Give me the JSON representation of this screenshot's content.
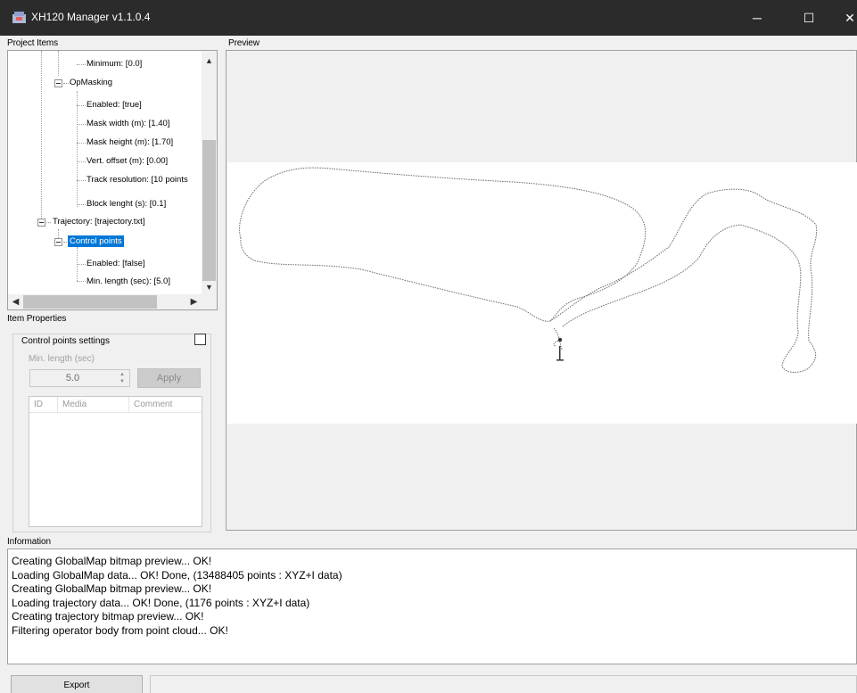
{
  "window": {
    "title": "XH120 Manager v1.1.0.4",
    "icon": "app-icon",
    "controls": {
      "minimize": "─",
      "maximize": "☐",
      "close": "✕"
    }
  },
  "labels": {
    "project_items": "Project Items",
    "preview": "Preview",
    "item_properties": "Item Properties",
    "information": "Information"
  },
  "tree": {
    "items": [
      {
        "label": "Minimum: [0.0]"
      },
      {
        "label": "OpMasking"
      },
      {
        "label": "Enabled: [true]"
      },
      {
        "label": "Mask width (m): [1.40]"
      },
      {
        "label": "Mask height (m): [1.70]"
      },
      {
        "label": "Vert. offset (m): [0.00]"
      },
      {
        "label": "Track resolution: [10 points"
      },
      {
        "label": "Block lenght (s): [0.1]"
      },
      {
        "label": "Trajectory: [trajectory.txt]"
      },
      {
        "label": "Control points"
      },
      {
        "label": "Enabled: [false]"
      },
      {
        "label": "Min. length (sec): [5.0]"
      }
    ],
    "selected": "Control points"
  },
  "properties": {
    "group_title": "Control points settings",
    "checkbox_checked": false,
    "min_length_label": "Min. length (sec)",
    "min_length_value": "5.0",
    "apply_label": "Apply",
    "columns": [
      "ID",
      "Media",
      "Comment"
    ],
    "rows": []
  },
  "info": {
    "log": [
      "Creating GlobalMap bitmap preview... OK!",
      "Loading GlobalMap data... OK! Done, (13488405 points : XYZ+I data)",
      "Creating GlobalMap bitmap preview... OK!",
      "Loading trajectory data... OK! Done, (1176 points : XYZ+I data)",
      "Creating trajectory bitmap preview... OK!",
      "Filtering operator body from point cloud... OK!"
    ]
  },
  "bottom": {
    "export_label": "Export",
    "status_text": ""
  },
  "colors": {
    "titlebar": "#2b2b2b",
    "selection": "#0078d7",
    "trajectory": "#555555"
  }
}
